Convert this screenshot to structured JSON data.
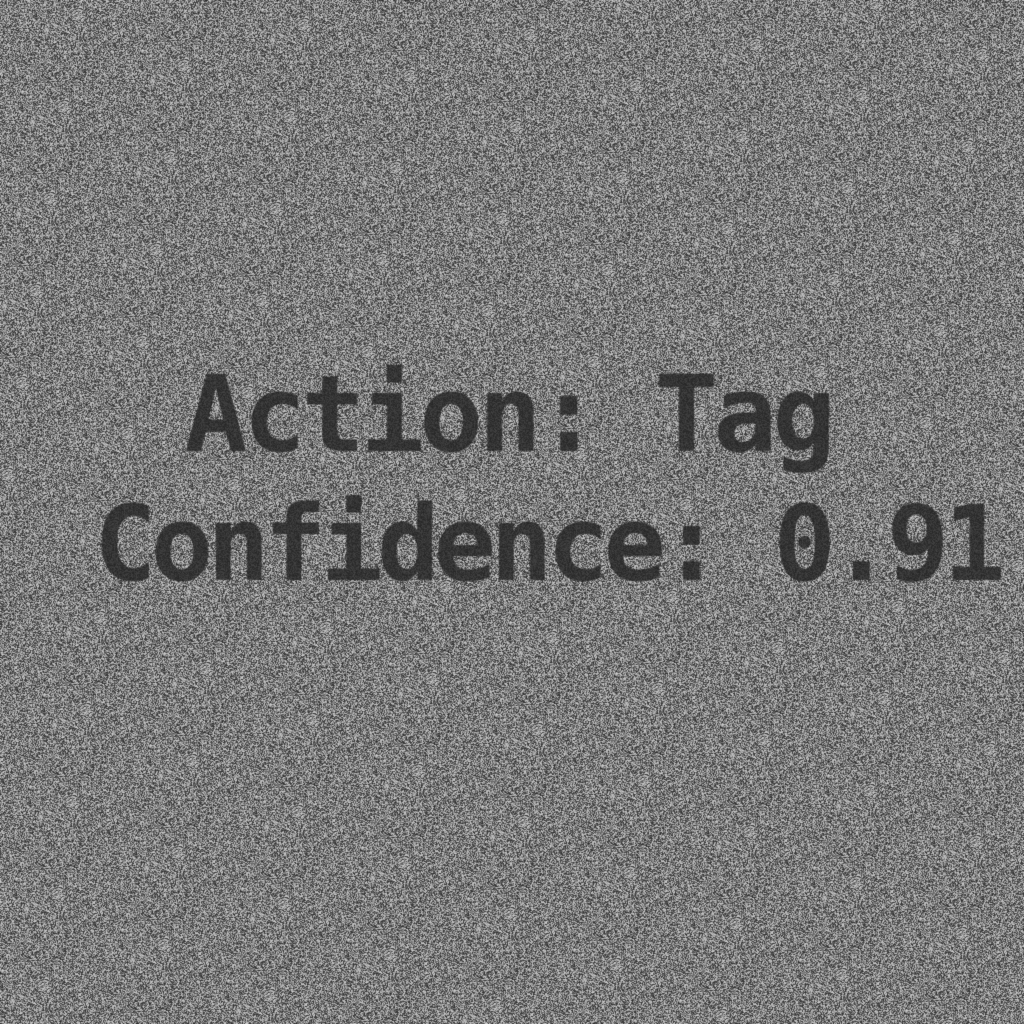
{
  "overlay": {
    "action_line": "Action: Tag",
    "confidence_line": "Confidence: 0.91"
  },
  "colors": {
    "background_gray": "#7a7a7a",
    "text_dark": "#252525"
  }
}
